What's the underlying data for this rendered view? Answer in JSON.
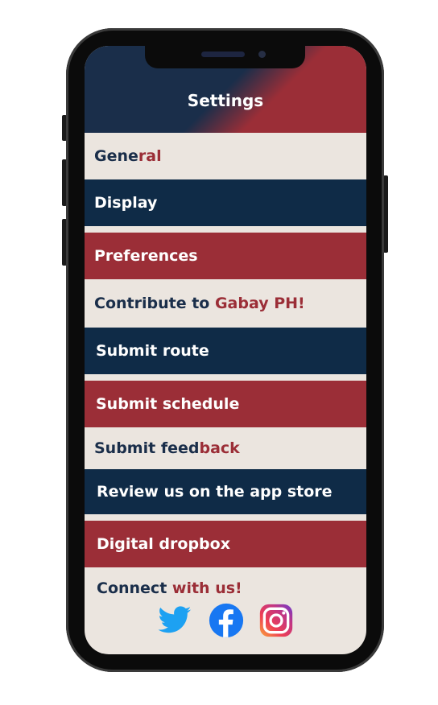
{
  "header": {
    "title": "Settings"
  },
  "general": {
    "prefix": "Gene",
    "accent": "ral"
  },
  "display": {
    "label": "Display"
  },
  "preferences": {
    "label": "Preferences"
  },
  "contribute": {
    "prefix": "Contribute to ",
    "accent": "Gabay PH!"
  },
  "submit_route": {
    "label": "Submit route"
  },
  "submit_schedule": {
    "label": "Submit schedule"
  },
  "submit_feedback": {
    "prefix": "Submit feed",
    "accent": "back"
  },
  "review": {
    "label": "Review us on the app store"
  },
  "dropbox": {
    "label": "Digital dropbox"
  },
  "connect": {
    "prefix": "Connect ",
    "accent": "with us!"
  },
  "socials": [
    "twitter-icon",
    "facebook-icon",
    "instagram-icon"
  ],
  "colors": {
    "navy": "#0f2b47",
    "red": "#9b2e37",
    "cream": "#ebe5df",
    "twitter": "#1da1f2",
    "facebook": "#1877f2"
  }
}
